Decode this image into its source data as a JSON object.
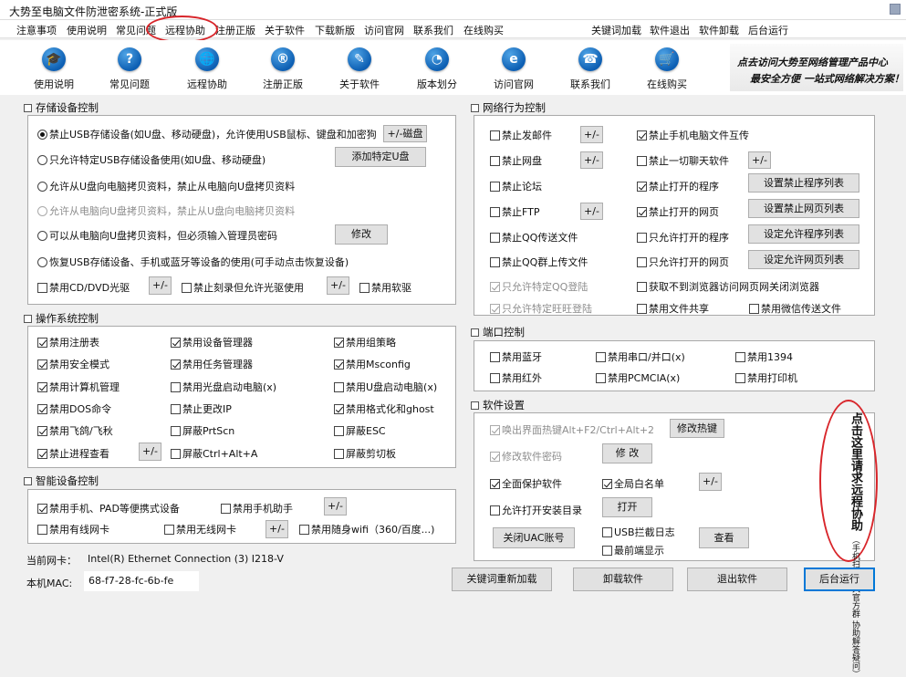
{
  "window": {
    "title": "大势至电脑文件防泄密系统-正式版"
  },
  "menu": [
    "注意事项",
    "使用说明",
    "常见问题",
    "远程协助",
    "注册正版",
    "关于软件",
    "下载新版",
    "访问官网",
    "联系我们",
    "在线购买",
    "关键词加载",
    "软件退出",
    "软件卸载",
    "后台运行"
  ],
  "toolbar": [
    {
      "label": "使用说明",
      "icon": "graduation-cap-icon",
      "glyph": "🎓"
    },
    {
      "label": "常见问题",
      "icon": "question-icon",
      "glyph": "?"
    },
    {
      "label": "远程协助",
      "icon": "globe-icon",
      "glyph": "🌐"
    },
    {
      "label": "注册正版",
      "icon": "registered-icon",
      "glyph": "®"
    },
    {
      "label": "关于软件",
      "icon": "edit-icon",
      "glyph": "✎"
    },
    {
      "label": "版本划分",
      "icon": "pie-chart-icon",
      "glyph": "◔"
    },
    {
      "label": "访问官网",
      "icon": "ie-browser-icon",
      "glyph": "e"
    },
    {
      "label": "联系我们",
      "icon": "phone-icon",
      "glyph": "☎"
    },
    {
      "label": "在线购买",
      "icon": "cart-icon",
      "glyph": "🛒"
    }
  ],
  "banner": {
    "line1": "点去访问大势至网络管理产品中心",
    "line2": "最安全方便 一站式网络解决方案！"
  },
  "storage": {
    "title": "存储设备控制",
    "options": [
      "禁止USB存储设备(如U盘、移动硬盘)，允许使用USB鼠标、键盘和加密狗",
      "只允许特定USB存储设备使用(如U盘、移动硬盘)",
      "允许从U盘向电脑拷贝资料，禁止从电脑向U盘拷贝资料",
      "允许从电脑向U盘拷贝资料，禁止从U盘向电脑拷贝资料",
      "可以从电脑向U盘拷贝资料，但必须输入管理员密码",
      "恢复USB存储设备、手机或蓝牙等设备的使用(可手动点击恢复设备)"
    ],
    "btn_add_usb": "+/-磁盘",
    "btn_add_specific": "添加特定U盘",
    "btn_modify": "修改",
    "cd": "禁用CD/DVD光驱",
    "burn": "禁止刻录但允许光驱使用",
    "floppy": "禁用软驱",
    "pm": "+/-"
  },
  "os": {
    "title": "操作系统控制",
    "items": [
      "禁用注册表",
      "禁用设备管理器",
      "禁用组策略",
      "禁用安全模式",
      "禁用任务管理器",
      "禁用Msconfig",
      "禁用计算机管理",
      "禁用光盘启动电脑(x)",
      "禁用U盘启动电脑(x)",
      "禁用DOS命令",
      "禁止更改IP",
      "禁用格式化和ghost",
      "禁用飞鸽/飞秋",
      "屏蔽PrtScn",
      "屏蔽ESC",
      "禁止进程查看",
      "屏蔽Ctrl+Alt+A",
      "屏蔽剪切板"
    ],
    "pm": "+/-"
  },
  "smart": {
    "title": "智能设备控制",
    "phone": "禁用手机、PAD等便携式设备",
    "assistant": "禁用手机助手",
    "wired": "禁用有线网卡",
    "wireless": "禁用无线网卡",
    "wifi": "禁用随身wifi（360/百度...)",
    "pm": "+/-"
  },
  "netinfo": {
    "nic_label": "当前网卡：",
    "nic_value": "Intel(R) Ethernet Connection (3) I218-V",
    "mac_label": "本机MAC:",
    "mac_value": "68-f7-28-fc-6b-fe"
  },
  "network": {
    "title": "网络行为控制",
    "left": [
      "禁止发邮件",
      "禁止网盘",
      "禁止论坛",
      "禁止FTP",
      "禁止QQ传送文件",
      "禁止QQ群上传文件",
      "只允许特定QQ登陆",
      "只允许特定旺旺登陆"
    ],
    "right": [
      "禁止手机电脑文件互传",
      "禁止一切聊天软件",
      "禁止打开的程序",
      "禁止打开的网页",
      "只允许打开的程序",
      "只允许打开的网页",
      "获取不到浏览器访问网页网关闭浏览器",
      "禁用文件共享"
    ],
    "wechat": "禁用微信传送文件",
    "buttons": [
      "设置禁止程序列表",
      "设置禁止网页列表",
      "设定允许程序列表",
      "设定允许网页列表"
    ],
    "pm": "+/-"
  },
  "port": {
    "title": "端口控制",
    "items": [
      "禁用蓝牙",
      "禁用串口/并口(x)",
      "禁用1394",
      "禁用红外",
      "禁用PCMCIA(x)",
      "禁用打印机"
    ]
  },
  "software": {
    "title": "软件设置",
    "hotkey": "唤出界面热键Alt+F2/Ctrl+Alt+2",
    "btn_hotkey": "修改热键",
    "password": "修改软件密码",
    "btn_change": "修 改",
    "protect": "全面保护软件",
    "whitelist": "全局白名单",
    "pm": "+/-",
    "allow_install": "允许打开安装目录",
    "btn_open": "打开",
    "btn_uac": "关闭UAC账号",
    "usb_log": "USB拦截日志",
    "min_show": "最前端显示",
    "btn_view": "查看",
    "side_lines": [
      "点击这里请求远程协助",
      "（手机扫码加入官方群  协助解答疑问）"
    ]
  },
  "bottom": {
    "reload": "关键词重新加载",
    "uninstall": "卸载软件",
    "exit": "退出软件",
    "background": "后台运行"
  }
}
